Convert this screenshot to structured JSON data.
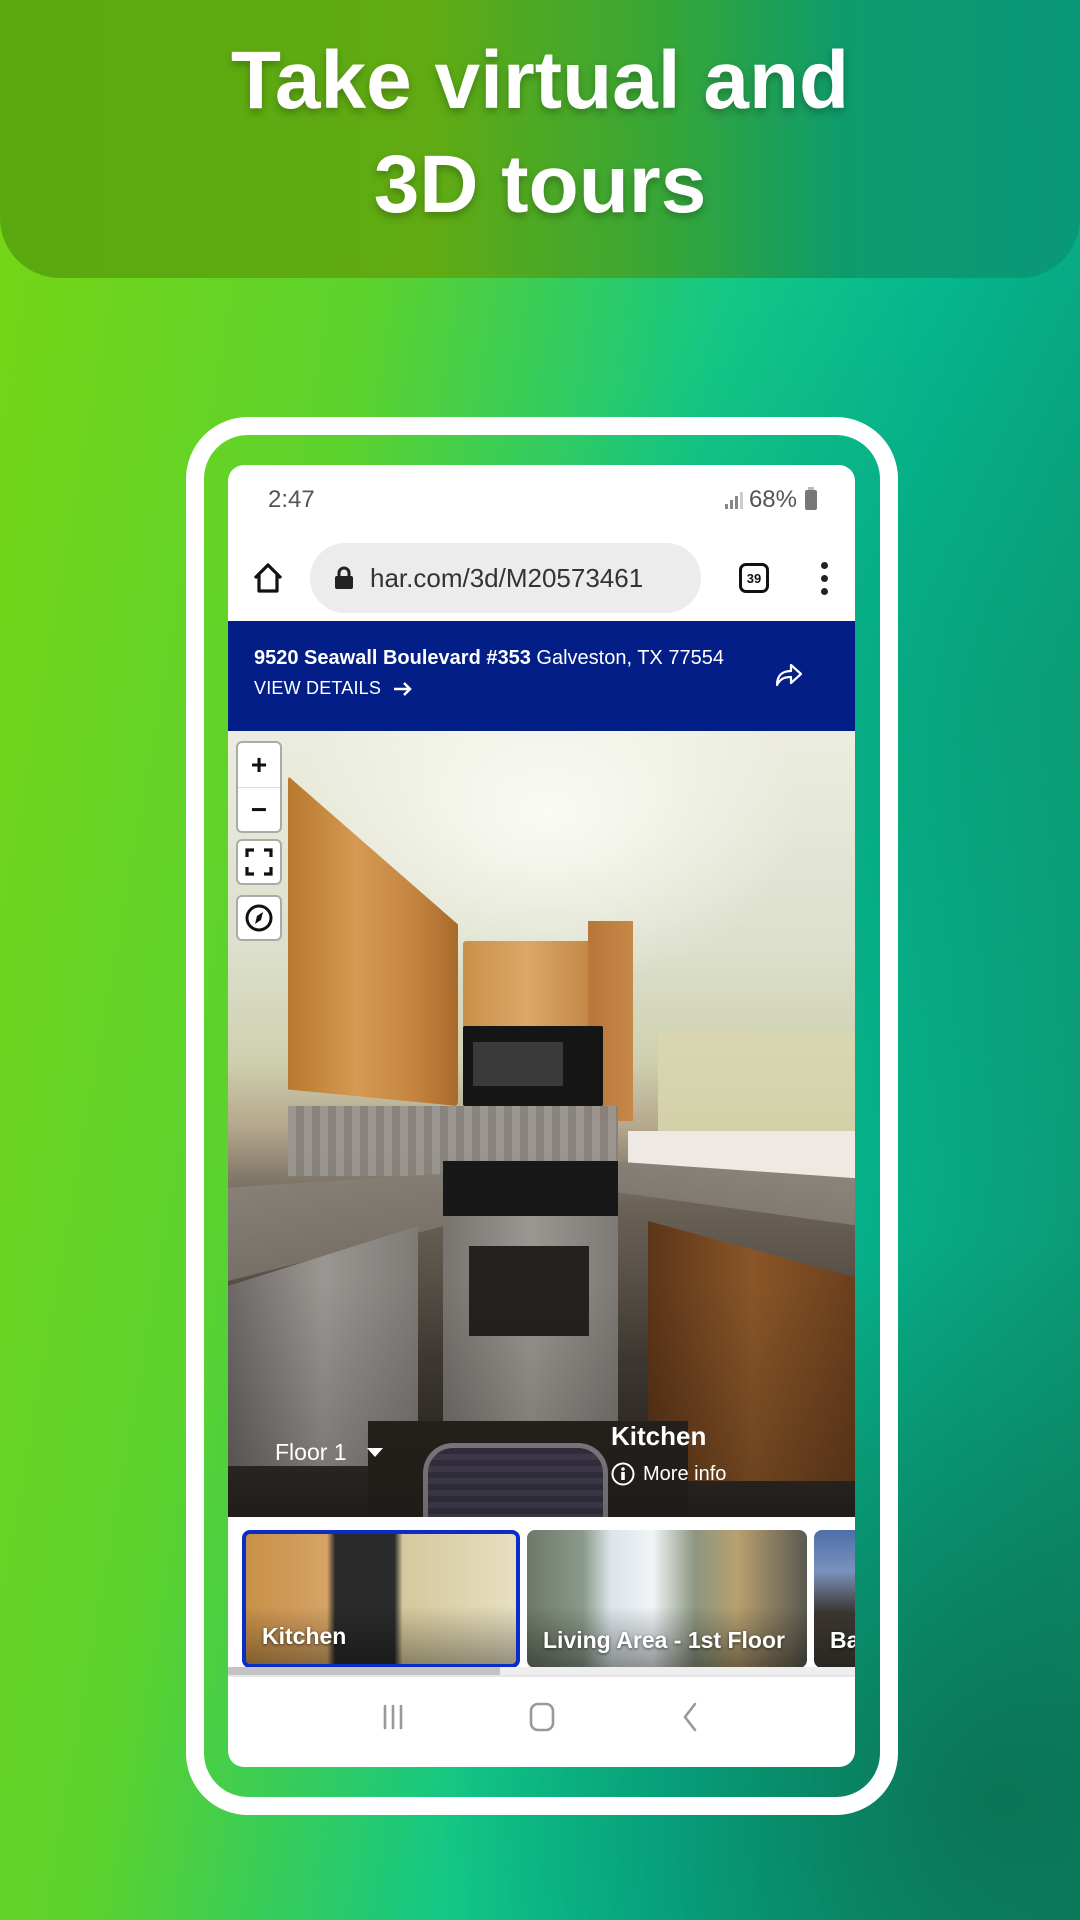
{
  "promo": {
    "headline_line1": "Take virtual and",
    "headline_line2": "3D tours"
  },
  "status_bar": {
    "time": "2:47",
    "battery": "68%",
    "icons": [
      "signal-icon",
      "battery-icon"
    ]
  },
  "browser": {
    "home_icon": "home-icon",
    "lock_icon": "lock-icon",
    "url": "har.com/3d/M20573461",
    "tab_count": "39",
    "menu_icon": "more-vert-icon"
  },
  "listing": {
    "street": "9520 Seawall Boulevard #353",
    "city": "Galveston, TX 77554",
    "view_details_label": "VIEW DETAILS",
    "share_icon": "share-icon",
    "brand_color": "#031f87"
  },
  "viewer": {
    "zoom_in_label": "+",
    "zoom_out_label": "−",
    "fullscreen_icon": "fullscreen-icon",
    "compass_icon": "compass-icon",
    "floor_label": "Floor 1",
    "room_name": "Kitchen",
    "more_info_label": "More info"
  },
  "rooms": [
    {
      "label": "Kitchen",
      "selected": true
    },
    {
      "label": "Living Area - 1st Floor",
      "selected": false
    },
    {
      "label": "Ba",
      "selected": false
    }
  ],
  "thumbnail_scroll": {
    "position_fraction": 0.43
  },
  "nav_bar": {
    "recents_icon": "recents-icon",
    "home_icon": "home-nav-icon",
    "back_icon": "back-icon"
  },
  "colors": {
    "selected_border": "#0b2cc9",
    "background_green": "#78d614",
    "background_teal": "#0d8f6c"
  }
}
